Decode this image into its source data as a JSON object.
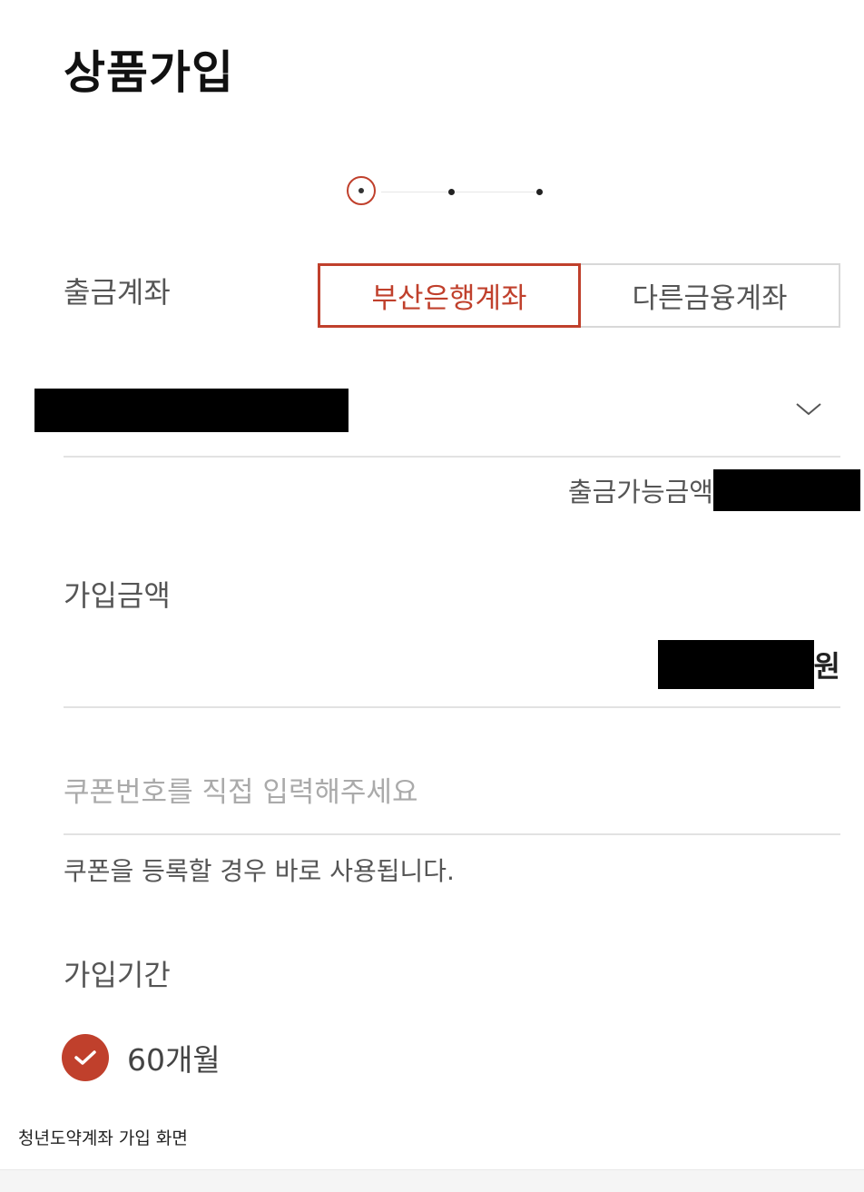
{
  "page": {
    "title": "상품가입"
  },
  "stepper": {
    "steps": 3,
    "current": 1
  },
  "withdrawal_account": {
    "label": "출금계좌",
    "options": [
      "부산은행계좌",
      "다른금융계좌"
    ],
    "selected": "부산은행계좌",
    "account_value_masked": true,
    "available_label": "출금가능금액"
  },
  "signup_amount": {
    "label": "가입금액",
    "unit": "원"
  },
  "coupon": {
    "placeholder": "쿠폰번호를 직접 입력해주세요",
    "value": "",
    "help": "쿠폰을 등록할 경우 바로 사용됩니다."
  },
  "signup_period": {
    "label": "가입기간",
    "option": "60개월",
    "checked": true
  },
  "caption": "청년도약계좌 가입 화면",
  "colors": {
    "accent": "#c0402c",
    "label_text": "#555555",
    "placeholder": "#aaaaaa",
    "divider": "#e2e2e2"
  }
}
